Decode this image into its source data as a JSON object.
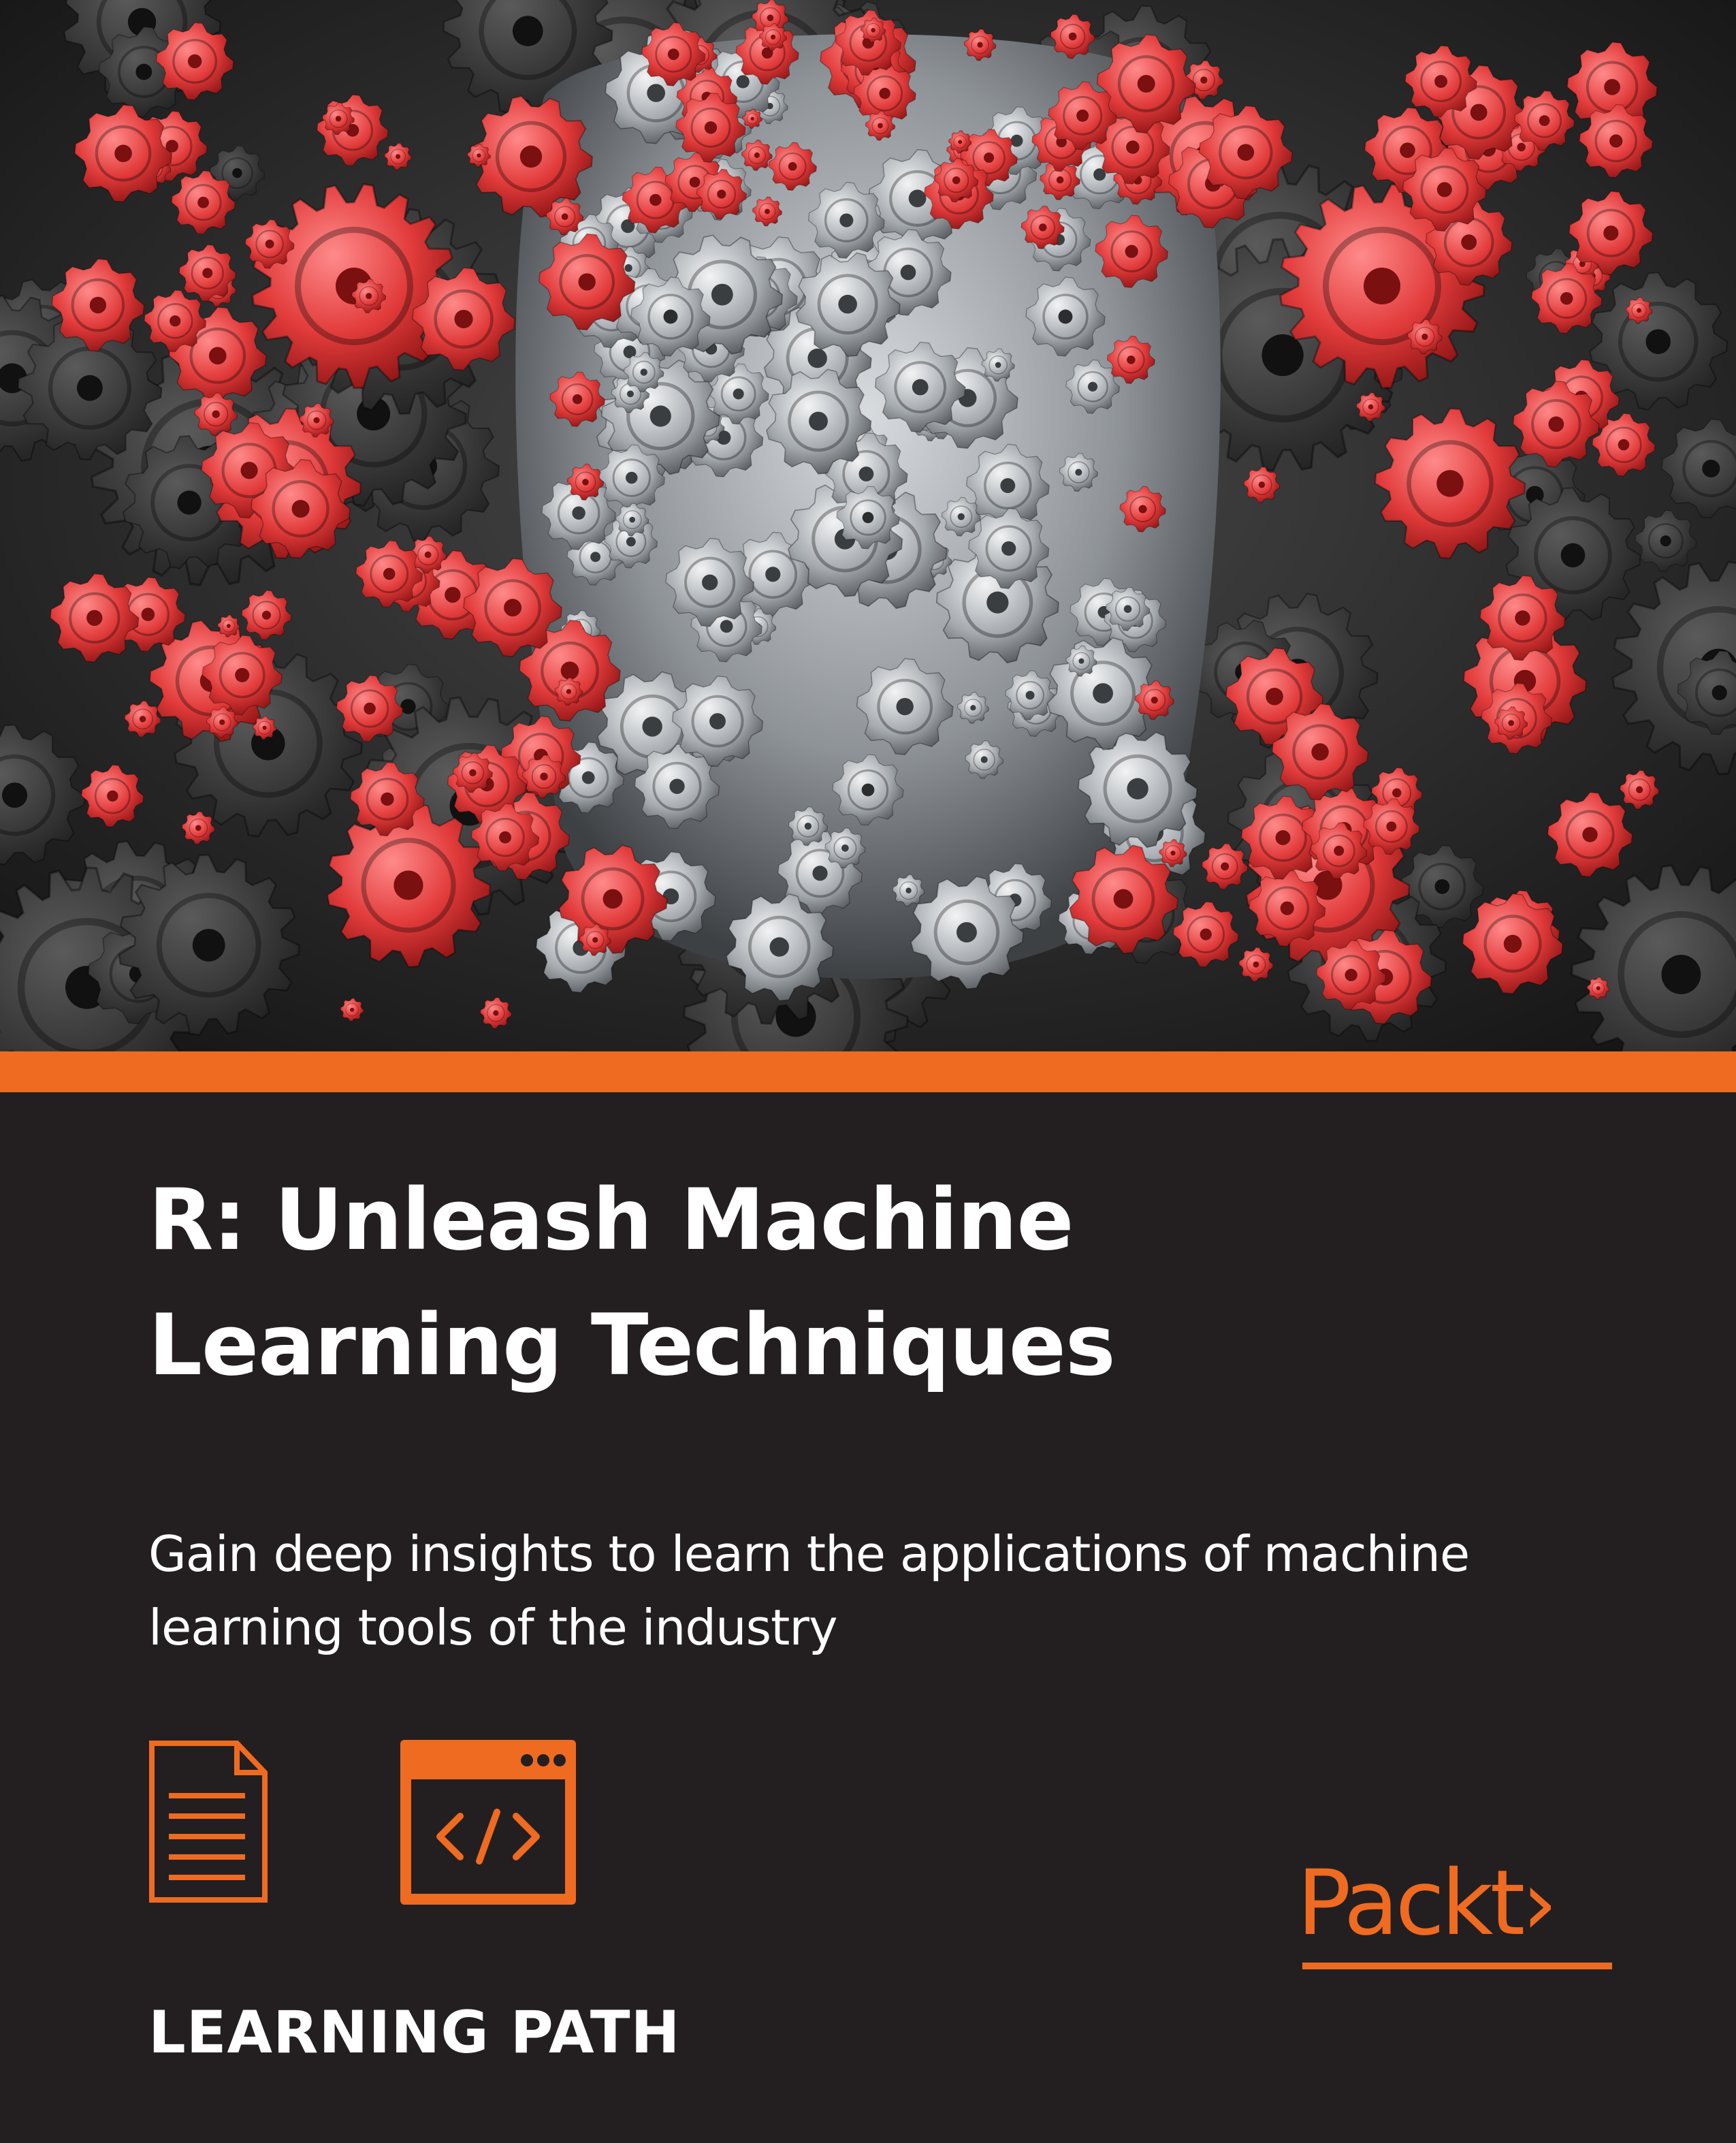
{
  "cover": {
    "title_lines": [
      "R: Unleash Machine",
      "Learning Techniques"
    ],
    "subtitle_lines": [
      "Gain deep insights to learn the applications of machine",
      "learning tools of the industry"
    ],
    "series_label": "LEARNING PATH",
    "publisher": "Packt",
    "publisher_glyph": "›",
    "artwork": "gear-head-illustration",
    "icons": [
      "document-icon",
      "code-window-icon",
      "packt-logo-icon"
    ],
    "colors": {
      "background": "#231f20",
      "accent": "#ee6b21",
      "gear_red": "#e23b3b",
      "gear_silver": "#9aa0a6",
      "text": "#ffffff"
    }
  }
}
